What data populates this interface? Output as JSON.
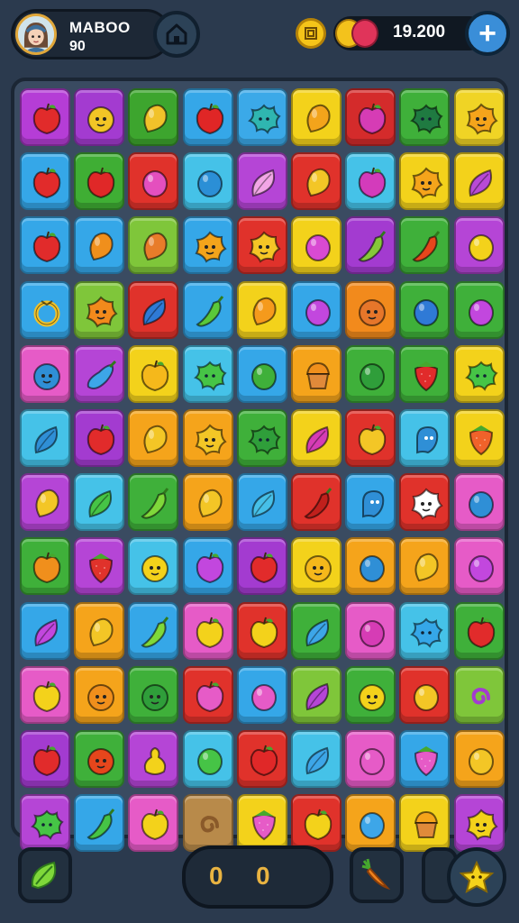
{
  "player": {
    "name": "MABOO",
    "level": "90",
    "avatar_icon": "avatar-girl-icon"
  },
  "header": {
    "home_icon": "home-icon",
    "coin_icon": "coin-icon",
    "currency_value": "19.200",
    "add_button_label": "+"
  },
  "board": {
    "rows": 12,
    "cols": 9,
    "tiles": [
      [
        [
          "#b53dd6",
          "apple",
          "#e12b2b"
        ],
        [
          "#a33bd0",
          "face",
          "#f2c526"
        ],
        [
          "#3da52e",
          "mango",
          "#f1c22a"
        ],
        [
          "#35a7e8",
          "apple",
          "#e02626"
        ],
        [
          "#3ba9e8",
          "splat",
          "#2fb6b0"
        ],
        [
          "#f3d21b",
          "mango",
          "#f3a41b"
        ],
        [
          "#d42b2b",
          "apple",
          "#d63cb5"
        ],
        [
          "#3fb03a",
          "splat",
          "#1f7a41"
        ],
        [
          "#f0d425",
          "flower",
          "#f5a41b"
        ]
      ],
      [
        [
          "#35a7e8",
          "apple",
          "#e12b2b"
        ],
        [
          "#3fae34",
          "apple",
          "#e02828"
        ],
        [
          "#e0322b",
          "plum",
          "#e44fbe"
        ],
        [
          "#45c2e8",
          "plum",
          "#2b8fd6"
        ],
        [
          "#b545d6",
          "leaf",
          "#f2a6e6"
        ],
        [
          "#e0322b",
          "mango",
          "#f3c626"
        ],
        [
          "#45c2e8",
          "apple",
          "#d33bbb"
        ],
        [
          "#f3d21b",
          "flower",
          "#f5a41b"
        ],
        [
          "#f3d21b",
          "leaf",
          "#b94ad6"
        ]
      ],
      [
        [
          "#35a7e8",
          "apple",
          "#e12b2b"
        ],
        [
          "#35a7e8",
          "mango",
          "#f08f1c"
        ],
        [
          "#7fc63a",
          "mango",
          "#e87c2a"
        ],
        [
          "#35a7e8",
          "flower",
          "#f3a41b"
        ],
        [
          "#e0322b",
          "flower",
          "#f5c626"
        ],
        [
          "#f3d21b",
          "plum",
          "#d94ad2"
        ],
        [
          "#a33bd0",
          "pepper",
          "#86c83a"
        ],
        [
          "#3fb03a",
          "pepper",
          "#e6461c"
        ],
        [
          "#b545d6",
          "plum",
          "#f3d21b"
        ]
      ],
      [
        [
          "#35a7e8",
          "ring",
          "#f1c22a"
        ],
        [
          "#7fc63a",
          "flower",
          "#f28a1c"
        ],
        [
          "#e0322b",
          "leaf",
          "#2f7ad6"
        ],
        [
          "#35a7e8",
          "pepper",
          "#5ac83a"
        ],
        [
          "#f3d21b",
          "mango",
          "#f59a1c"
        ],
        [
          "#35a7e8",
          "plum",
          "#c247de"
        ],
        [
          "#f28a1c",
          "face",
          "#e6762a"
        ],
        [
          "#3fb03a",
          "plum",
          "#2f7ad6"
        ],
        [
          "#3fb03a",
          "plum",
          "#c247de"
        ]
      ],
      [
        [
          "#e65bc7",
          "face",
          "#2f8fd6"
        ],
        [
          "#b545d6",
          "eggplant",
          "#3da6e8"
        ],
        [
          "#f3d21b",
          "apple",
          "#f5b81b"
        ],
        [
          "#45c2e8",
          "splat",
          "#46c446"
        ],
        [
          "#35a7e8",
          "plum",
          "#3fb03a"
        ],
        [
          "#f5a41b",
          "cupcake",
          "#f08f1c"
        ],
        [
          "#3fb03a",
          "plum",
          "#2f9e3a"
        ],
        [
          "#3fb03a",
          "strawberry",
          "#e12b2b"
        ],
        [
          "#f3d21b",
          "splat",
          "#46c446"
        ]
      ],
      [
        [
          "#45c2e8",
          "leaf",
          "#2f8fd6"
        ],
        [
          "#a33bd0",
          "apple",
          "#e12b2b"
        ],
        [
          "#f5a41b",
          "mango",
          "#f3c626"
        ],
        [
          "#f5a41b",
          "flower",
          "#f3c626"
        ],
        [
          "#3fb03a",
          "splat",
          "#2f9e3a"
        ],
        [
          "#f3d21b",
          "leaf",
          "#d63cb5"
        ],
        [
          "#e0322b",
          "apple",
          "#f3c626"
        ],
        [
          "#45c2e8",
          "ghost",
          "#2f8fd6"
        ],
        [
          "#f3d21b",
          "strawberry",
          "#f0622a"
        ]
      ],
      [
        [
          "#b545d6",
          "mango",
          "#f3c626"
        ],
        [
          "#45c2e8",
          "leaf",
          "#46c446"
        ],
        [
          "#3fb03a",
          "pepper",
          "#7fd83a"
        ],
        [
          "#f5a41b",
          "mango",
          "#f3c626"
        ],
        [
          "#35a7e8",
          "leaf",
          "#46c0e8"
        ],
        [
          "#e0322b",
          "pepper",
          "#c0201c"
        ],
        [
          "#35a7e8",
          "ghost",
          "#2f8fd6"
        ],
        [
          "#e0322b",
          "flower",
          "#ffffff"
        ],
        [
          "#e65bc7",
          "plum",
          "#2f8fd6"
        ]
      ],
      [
        [
          "#3fb03a",
          "apple",
          "#f08f1c"
        ],
        [
          "#b545d6",
          "strawberry",
          "#e0322b"
        ],
        [
          "#45c2e8",
          "face",
          "#f3d21b"
        ],
        [
          "#35a7e8",
          "apple",
          "#c247de"
        ],
        [
          "#a33bd0",
          "apple",
          "#e12b2b"
        ],
        [
          "#f3d21b",
          "face",
          "#f5b81b"
        ],
        [
          "#f5a41b",
          "plum",
          "#2f8fd6"
        ],
        [
          "#f5a41b",
          "mango",
          "#f3c626"
        ],
        [
          "#e65bc7",
          "plum",
          "#c247de"
        ]
      ],
      [
        [
          "#35a7e8",
          "leaf",
          "#c247de"
        ],
        [
          "#f5a41b",
          "mango",
          "#f3c626"
        ],
        [
          "#35a7e8",
          "pepper",
          "#7fd83a"
        ],
        [
          "#e65bc7",
          "apple",
          "#f3d21b"
        ],
        [
          "#e0322b",
          "apple",
          "#f3d21b"
        ],
        [
          "#3fb03a",
          "leaf",
          "#3da6e8"
        ],
        [
          "#e65bc7",
          "plum",
          "#d63cb5"
        ],
        [
          "#45c2e8",
          "splat",
          "#35a7e8"
        ],
        [
          "#3fb03a",
          "apple",
          "#e12b2b"
        ]
      ],
      [
        [
          "#e65bc7",
          "apple",
          "#f3d21b"
        ],
        [
          "#f5a41b",
          "face",
          "#f08f1c"
        ],
        [
          "#3fb03a",
          "face",
          "#2f9e3a"
        ],
        [
          "#e0322b",
          "apple",
          "#e65bc7"
        ],
        [
          "#35a7e8",
          "plum",
          "#e65bc7"
        ],
        [
          "#7fc63a",
          "leaf",
          "#b545d6"
        ],
        [
          "#3fb03a",
          "face",
          "#f3d21b"
        ],
        [
          "#e0322b",
          "plum",
          "#f3c626"
        ],
        [
          "#7fc63a",
          "swirl",
          "#a33bd0"
        ]
      ],
      [
        [
          "#a33bd0",
          "apple",
          "#e12b2b"
        ],
        [
          "#3fb03a",
          "face",
          "#e6461c"
        ],
        [
          "#b545d6",
          "pear",
          "#f3d21b"
        ],
        [
          "#45c2e8",
          "plum",
          "#46c446"
        ],
        [
          "#e0322b",
          "apple",
          "#e02828"
        ],
        [
          "#45c2e8",
          "leaf",
          "#3da6e8"
        ],
        [
          "#e65bc7",
          "plum",
          "#e65bc7"
        ],
        [
          "#35a7e8",
          "strawberry",
          "#e65bc7"
        ],
        [
          "#f5a41b",
          "plum",
          "#f3c626"
        ]
      ],
      [
        [
          "#b545d6",
          "splat",
          "#46c446"
        ],
        [
          "#35a7e8",
          "pepper",
          "#46c446"
        ],
        [
          "#e65bc7",
          "apple",
          "#f3d21b"
        ],
        [
          "#b88a4a",
          "swirl",
          "#8a5a2a"
        ],
        [
          "#f3d21b",
          "strawberry",
          "#e65bc7"
        ],
        [
          "#e0322b",
          "apple",
          "#f3d21b"
        ],
        [
          "#f5a41b",
          "plum",
          "#3da6e8"
        ],
        [
          "#f3d21b",
          "cupcake",
          "#f5a41b"
        ],
        [
          "#b545d6",
          "flower",
          "#f3d21b"
        ]
      ]
    ]
  },
  "bottom_bar": {
    "left_booster_icon": "leaf-booster-icon",
    "moves_value_a": "0",
    "moves_value_b": "0",
    "carrot_booster_icon": "carrot-booster-icon",
    "star_booster_icon": "star-booster-icon"
  }
}
